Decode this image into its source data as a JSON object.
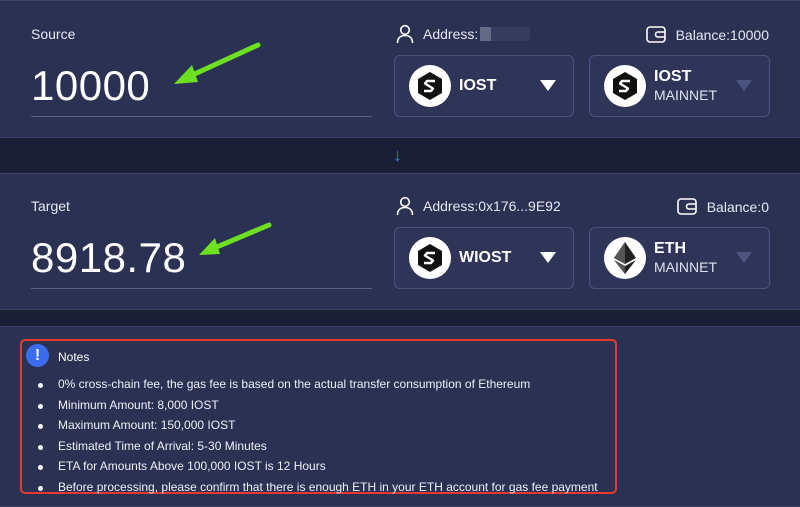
{
  "source": {
    "label": "Source",
    "amount": "10000",
    "address_label": "Address:",
    "address_value": "",
    "balance": "Balance:10000",
    "token": {
      "name": "IOST",
      "logo": "iost-logo-icon"
    },
    "network": {
      "name": "IOST",
      "sub": "MAINNET",
      "logo": "iost-logo-icon"
    }
  },
  "target": {
    "label": "Target",
    "amount": "8918.78",
    "address": "Address:0x176...9E92",
    "balance": "Balance:0",
    "token": {
      "name": "WIOST",
      "logo": "iost-logo-icon"
    },
    "network": {
      "name": "ETH",
      "sub": "MAINNET",
      "logo": "eth-logo-icon"
    }
  },
  "swap_arrow": "↓",
  "notes": {
    "icon": "!",
    "title": "Notes",
    "items": [
      "0% cross-chain fee, the gas fee is based on the actual transfer consumption of Ethereum",
      "Minimum Amount: 8,000 IOST",
      "Maximum Amount: 150,000 IOST",
      "Estimated Time of Arrival: 5-30 Minutes",
      "ETA for Amounts Above 100,000 IOST is 12 Hours",
      "Before processing, please confirm that there is enough ETH in your ETH account for gas fee payment"
    ]
  },
  "colors": {
    "background": "#1b1f36",
    "panel": "#2a3152",
    "accent_blue": "#3f74ff",
    "highlight_red": "#e53a2e",
    "annotation_green": "#6de021"
  }
}
